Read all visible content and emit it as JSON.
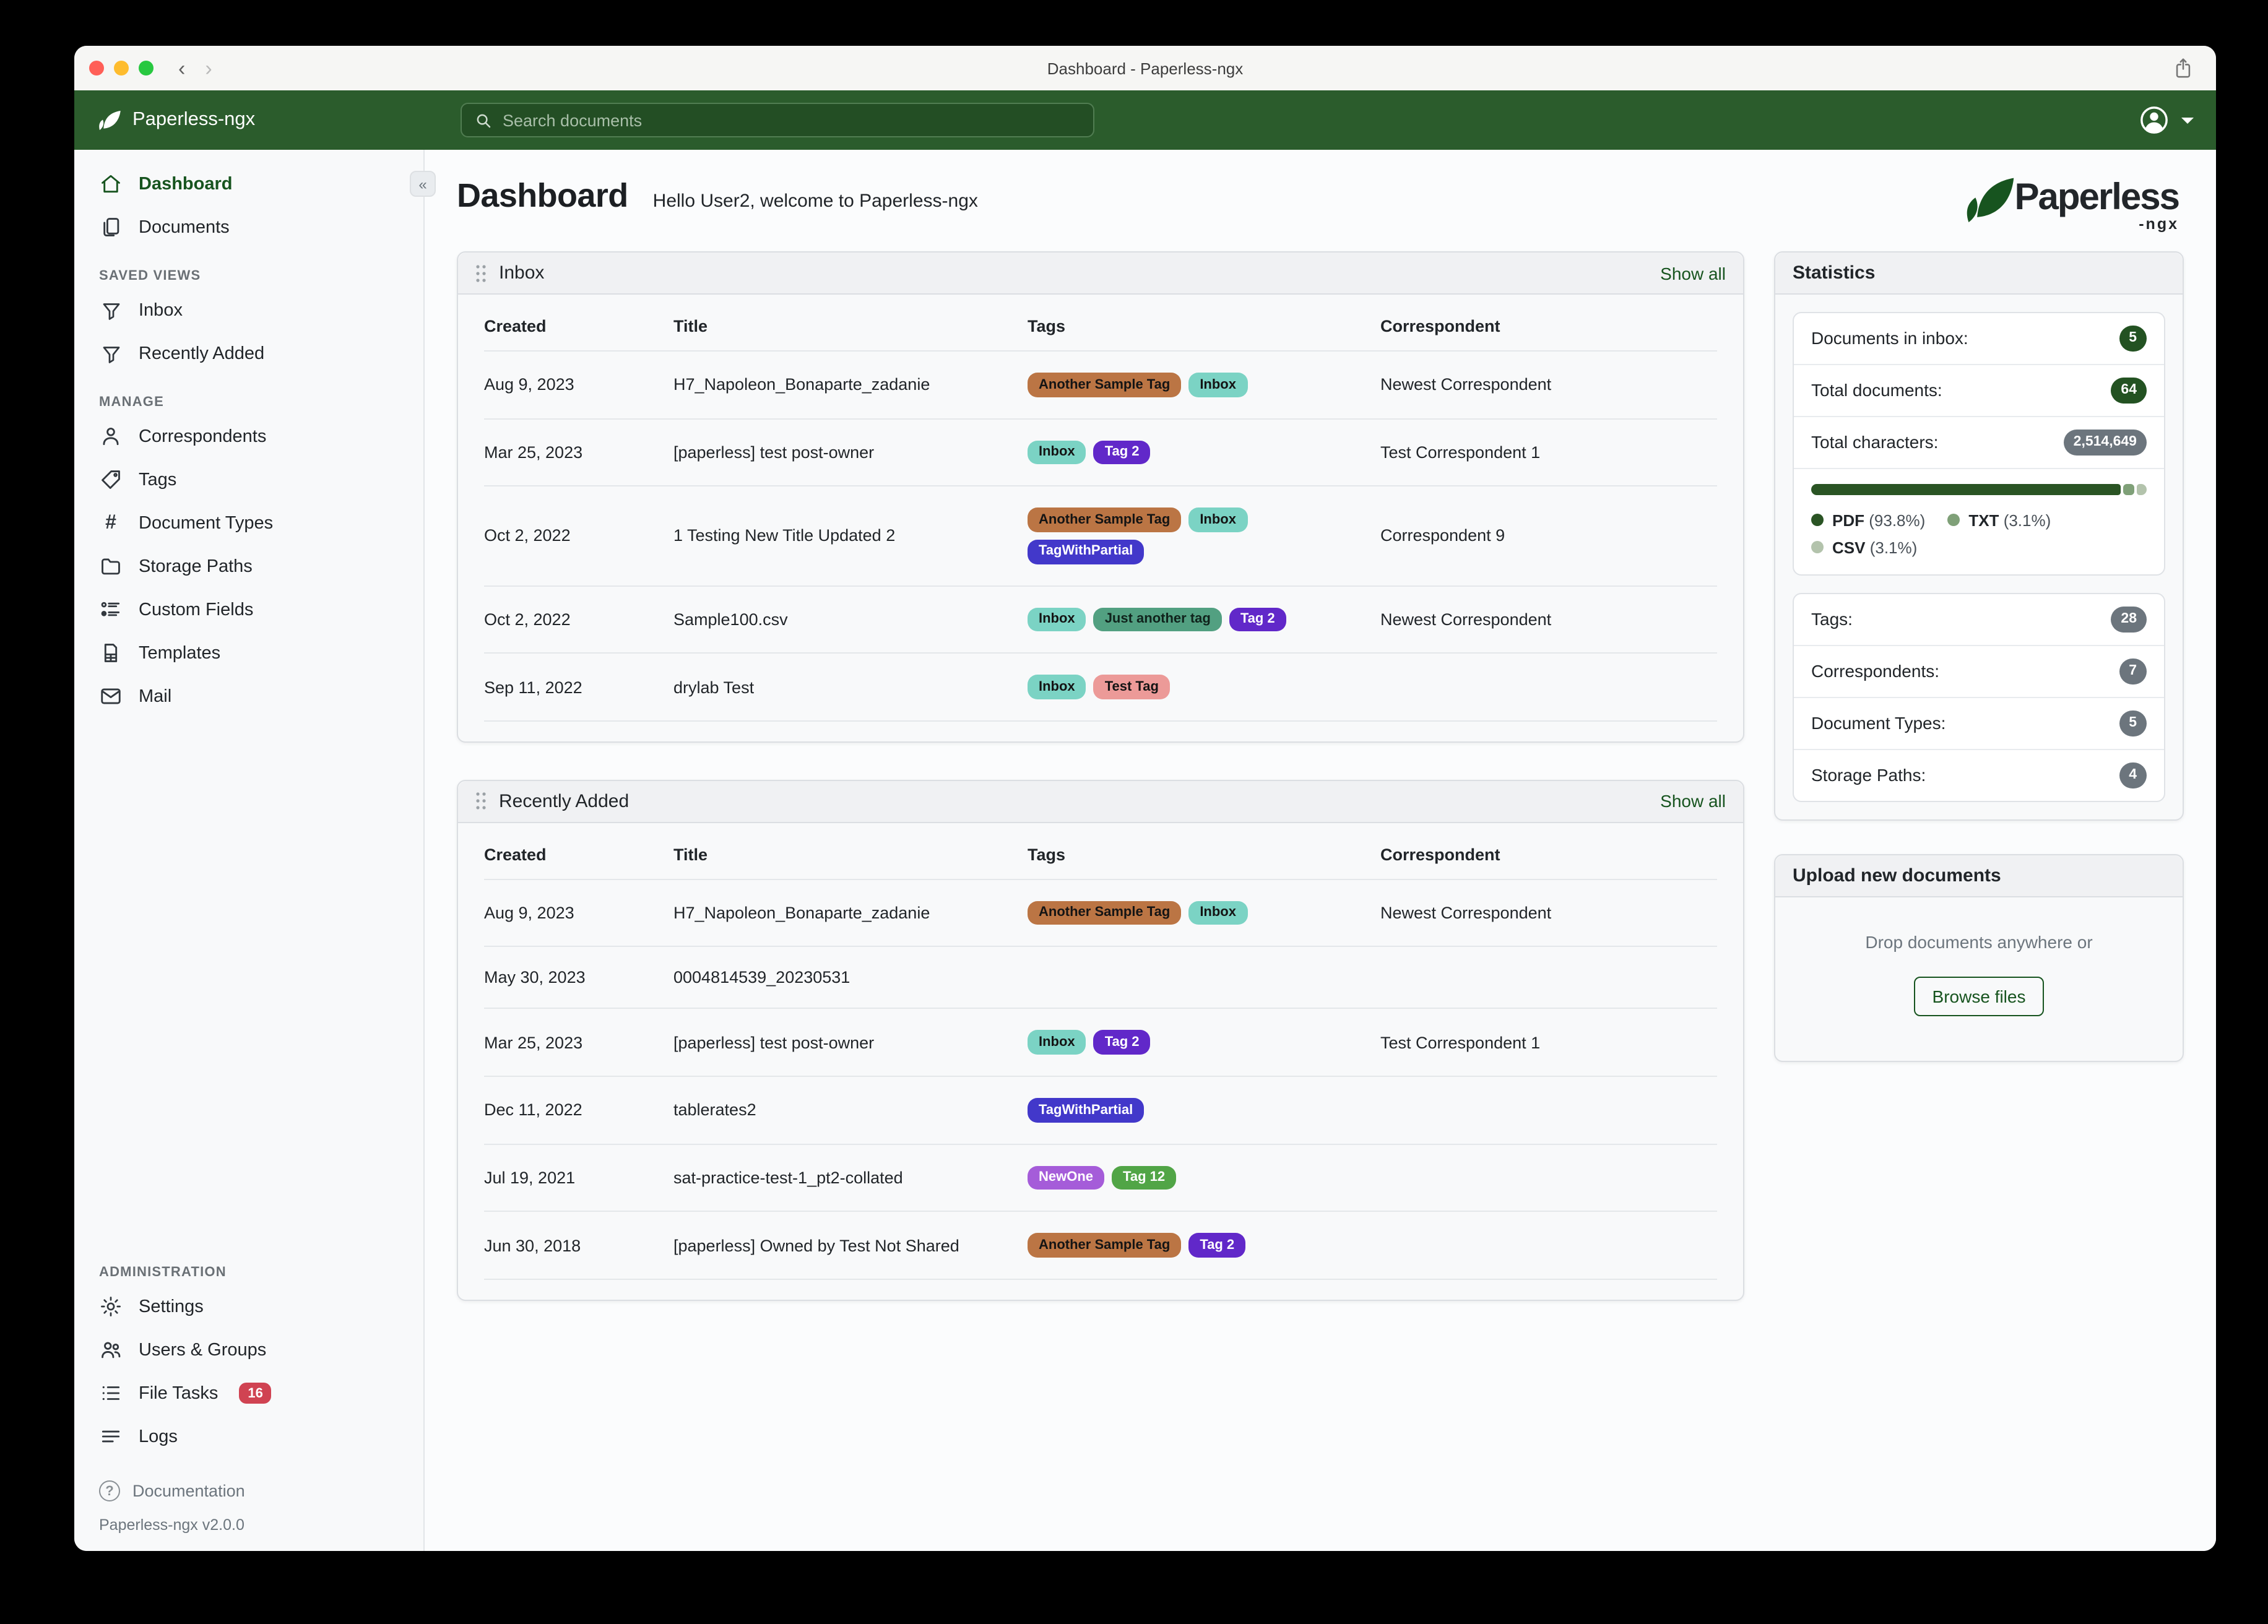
{
  "window": {
    "title": "Dashboard - Paperless-ngx"
  },
  "navbar": {
    "brand": "Paperless-ngx",
    "search_placeholder": "Search documents"
  },
  "sidebar": {
    "items": [
      {
        "label": "Dashboard"
      },
      {
        "label": "Documents"
      }
    ],
    "saved_views_label": "SAVED VIEWS",
    "saved_views": [
      {
        "label": "Inbox"
      },
      {
        "label": "Recently Added"
      }
    ],
    "manage_label": "MANAGE",
    "manage": [
      {
        "label": "Correspondents"
      },
      {
        "label": "Tags"
      },
      {
        "label": "Document Types"
      },
      {
        "label": "Storage Paths"
      },
      {
        "label": "Custom Fields"
      },
      {
        "label": "Templates"
      },
      {
        "label": "Mail"
      }
    ],
    "admin_label": "ADMINISTRATION",
    "admin": [
      {
        "label": "Settings"
      },
      {
        "label": "Users & Groups"
      },
      {
        "label": "File Tasks",
        "badge": "16"
      },
      {
        "label": "Logs"
      }
    ],
    "documentation": "Documentation",
    "version": "Paperless-ngx v2.0.0"
  },
  "header": {
    "title": "Dashboard",
    "greeting": "Hello User2, welcome to Paperless-ngx",
    "logo_text": "Paperless",
    "logo_sub": "-ngx"
  },
  "panels": {
    "inbox": {
      "title": "Inbox",
      "show_all": "Show all",
      "columns": [
        "Created",
        "Title",
        "Tags",
        "Correspondent"
      ],
      "rows": [
        {
          "created": "Aug 9, 2023",
          "title": "H7_Napoleon_Bonaparte_zadanie",
          "tags": [
            {
              "label": "Another Sample Tag",
              "bg": "#bb7544",
              "fg": "#141414"
            },
            {
              "label": "Inbox",
              "bg": "#7bd3c4",
              "fg": "#141414"
            }
          ],
          "correspondent": "Newest Correspondent"
        },
        {
          "created": "Mar 25, 2023",
          "title": "[paperless] test post-owner",
          "tags": [
            {
              "label": "Inbox",
              "bg": "#7bd3c4",
              "fg": "#141414"
            },
            {
              "label": "Tag 2",
              "bg": "#6128c9",
              "fg": "#ffffff"
            }
          ],
          "correspondent": "Test Correspondent 1"
        },
        {
          "created": "Oct 2, 2022",
          "title": "1 Testing New Title Updated 2",
          "tags": [
            {
              "label": "Another Sample Tag",
              "bg": "#bb7544",
              "fg": "#141414"
            },
            {
              "label": "Inbox",
              "bg": "#7bd3c4",
              "fg": "#141414"
            },
            {
              "label": "TagWithPartial",
              "bg": "#4238ca",
              "fg": "#ffffff"
            }
          ],
          "correspondent": "Correspondent 9"
        },
        {
          "created": "Oct 2, 2022",
          "title": "Sample100.csv",
          "tags": [
            {
              "label": "Inbox",
              "bg": "#7bd3c4",
              "fg": "#141414"
            },
            {
              "label": "Just another tag",
              "bg": "#52a081",
              "fg": "#10231c"
            },
            {
              "label": "Tag 2",
              "bg": "#6128c9",
              "fg": "#ffffff"
            }
          ],
          "correspondent": "Newest Correspondent"
        },
        {
          "created": "Sep 11, 2022",
          "title": "drylab Test",
          "tags": [
            {
              "label": "Inbox",
              "bg": "#7bd3c4",
              "fg": "#141414"
            },
            {
              "label": "Test Tag",
              "bg": "#ec9a98",
              "fg": "#141414"
            }
          ],
          "correspondent": ""
        }
      ]
    },
    "recently_added": {
      "title": "Recently Added",
      "show_all": "Show all",
      "columns": [
        "Created",
        "Title",
        "Tags",
        "Correspondent"
      ],
      "rows": [
        {
          "created": "Aug 9, 2023",
          "title": "H7_Napoleon_Bonaparte_zadanie",
          "tags": [
            {
              "label": "Another Sample Tag",
              "bg": "#bb7544",
              "fg": "#141414"
            },
            {
              "label": "Inbox",
              "bg": "#7bd3c4",
              "fg": "#141414"
            }
          ],
          "correspondent": "Newest Correspondent"
        },
        {
          "created": "May 30, 2023",
          "title": "0004814539_20230531",
          "tags": [],
          "correspondent": ""
        },
        {
          "created": "Mar 25, 2023",
          "title": "[paperless] test post-owner",
          "tags": [
            {
              "label": "Inbox",
              "bg": "#7bd3c4",
              "fg": "#141414"
            },
            {
              "label": "Tag 2",
              "bg": "#6128c9",
              "fg": "#ffffff"
            }
          ],
          "correspondent": "Test Correspondent 1"
        },
        {
          "created": "Dec 11, 2022",
          "title": "tablerates2",
          "tags": [
            {
              "label": "TagWithPartial",
              "bg": "#4238ca",
              "fg": "#ffffff"
            }
          ],
          "correspondent": ""
        },
        {
          "created": "Jul 19, 2021",
          "title": "sat-practice-test-1_pt2-collated",
          "tags": [
            {
              "label": "NewOne",
              "bg": "#a55cd9",
              "fg": "#ffffff"
            },
            {
              "label": "Tag 12",
              "bg": "#51a546",
              "fg": "#ffffff"
            }
          ],
          "correspondent": ""
        },
        {
          "created": "Jun 30, 2018",
          "title": "[paperless] Owned by Test Not Shared",
          "tags": [
            {
              "label": "Another Sample Tag",
              "bg": "#bb7544",
              "fg": "#141414"
            },
            {
              "label": "Tag 2",
              "bg": "#6128c9",
              "fg": "#ffffff"
            }
          ],
          "correspondent": ""
        }
      ]
    }
  },
  "statistics": {
    "title": "Statistics",
    "rows": [
      {
        "label": "Documents in inbox:",
        "value": "5"
      },
      {
        "label": "Total documents:",
        "value": "64"
      },
      {
        "label": "Total characters:",
        "value": "2,514,649"
      }
    ],
    "file_types": [
      {
        "name": "PDF",
        "pct": 93.8,
        "pct_text": "(93.8%)",
        "color": "#2a5424"
      },
      {
        "name": "TXT",
        "pct": 3.1,
        "pct_text": "(3.1%)",
        "color": "#7fa078"
      },
      {
        "name": "CSV",
        "pct": 3.1,
        "pct_text": "(3.1%)",
        "color": "#b3c3ac"
      }
    ],
    "counts": [
      {
        "label": "Tags:",
        "value": "28"
      },
      {
        "label": "Correspondents:",
        "value": "7"
      },
      {
        "label": "Document Types:",
        "value": "5"
      },
      {
        "label": "Storage Paths:",
        "value": "4"
      }
    ]
  },
  "upload": {
    "title": "Upload new documents",
    "drop_text": "Drop documents anywhere or",
    "browse_label": "Browse files"
  },
  "colors": {
    "accent_green": "#17541f",
    "navbar_green": "#2b5c2c",
    "badge_green": "#235222",
    "badge_gray": "#6c757d",
    "file_tasks_badge": "#d04352"
  }
}
